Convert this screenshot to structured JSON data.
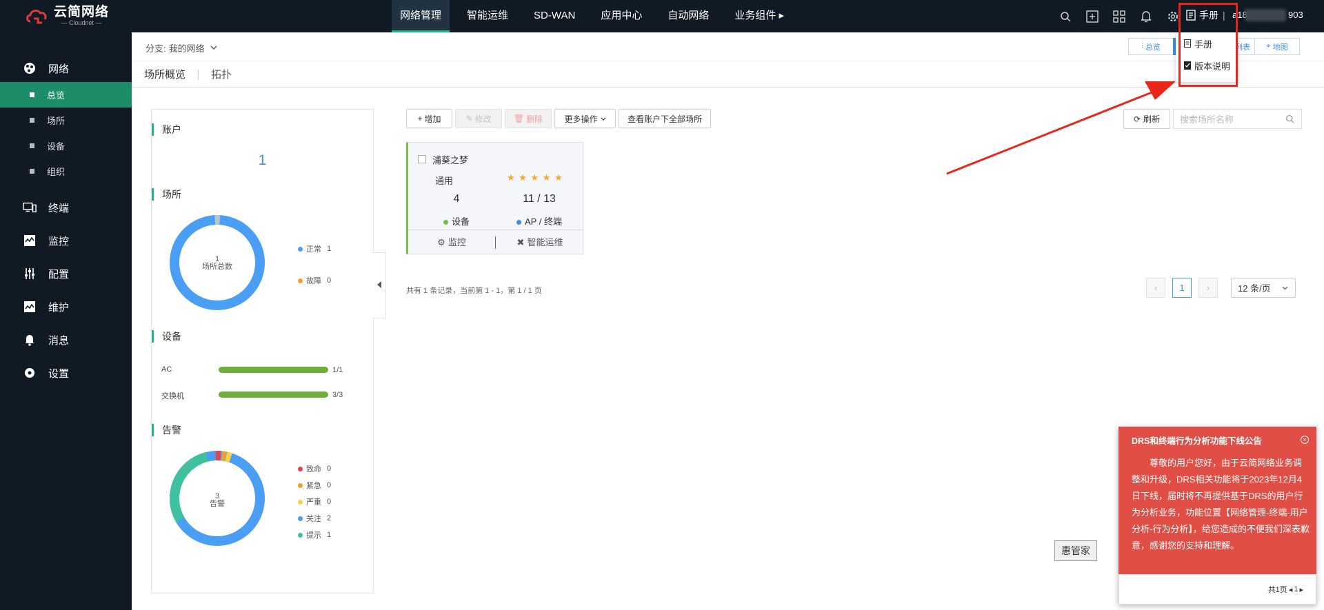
{
  "app": {
    "logo_title": "云简网络",
    "logo_sub": "— Cloudnet —"
  },
  "nav": {
    "items": [
      "网络管理",
      "智能运维",
      "SD-WAN",
      "应用中心",
      "自动网络",
      "业务组件 ▸"
    ]
  },
  "top": {
    "manual_label": "手册",
    "user_prefix": "a18",
    "user_suffix": "903"
  },
  "manual_menu": {
    "items": [
      "手册",
      "版本说明"
    ]
  },
  "sidebar": {
    "groups": [
      {
        "label": "网络",
        "icon": "network-icon"
      },
      {
        "label": "终端",
        "icon": "terminal-icon"
      },
      {
        "label": "监控",
        "icon": "monitor-icon"
      },
      {
        "label": "配置",
        "icon": "config-icon"
      },
      {
        "label": "维护",
        "icon": "maintain-icon"
      },
      {
        "label": "消息",
        "icon": "bell-icon"
      },
      {
        "label": "设置",
        "icon": "gear-icon"
      }
    ],
    "subs": [
      "总览",
      "场所",
      "设备",
      "组织"
    ]
  },
  "branch": {
    "label": "分支:",
    "value": "我的网络"
  },
  "view_buttons": {
    "overview": "总览",
    "list": "列表",
    "map": "地图"
  },
  "tabs": {
    "site_overview": "场所概览",
    "topology": "拓扑"
  },
  "panel": {
    "account": {
      "title": "账户",
      "count": "1"
    },
    "site": {
      "title": "场所",
      "center_num": "1",
      "center_label": "场所总数",
      "legend": [
        {
          "label": "正常",
          "value": "1",
          "color": "#4a9ff5"
        },
        {
          "label": "故障",
          "value": "0",
          "color": "#f0a030"
        }
      ]
    },
    "device": {
      "title": "设备",
      "rows": [
        {
          "label": "AC",
          "value": "1/1",
          "fraction": 1.0
        },
        {
          "label": "交换机",
          "value": "3/3",
          "fraction": 1.0
        }
      ]
    },
    "alarm": {
      "title": "告警",
      "center_num": "3",
      "center_label": "告警",
      "legend": [
        {
          "label": "致命",
          "value": "0",
          "color": "#e0464e"
        },
        {
          "label": "紧急",
          "value": "0",
          "color": "#f0a030"
        },
        {
          "label": "严重",
          "value": "0",
          "color": "#f7d24a"
        },
        {
          "label": "关注",
          "value": "2",
          "color": "#4a9ff5"
        },
        {
          "label": "提示",
          "value": "1",
          "color": "#3fc1a0"
        }
      ]
    }
  },
  "toolbar": {
    "add": "增加",
    "edit": "修改",
    "delete": "删除",
    "more": "更多操作",
    "view_all": "查看账户下全部场所"
  },
  "refresh": "刷新",
  "search": {
    "placeholder": "搜索场所名称"
  },
  "site_card": {
    "name": "浦葵之梦",
    "type": "通用",
    "stars": "★ ★ ★ ★ ★",
    "device_count": "4",
    "ap_count": "11 / 13",
    "device_label": "设备",
    "ap_label": "AP / 终端",
    "monitor": "监控",
    "ops": "智能运维"
  },
  "pager": {
    "info": "共有 1 条记录，当前第 1 - 1，第 1 / 1 页",
    "current": "1",
    "per_page": "12 条/页"
  },
  "hui_button": "惠管家",
  "notice": {
    "title": "DRS和终端行为分析功能下线公告",
    "body": "尊敬的用户您好，由于云简网络业务调整和升级，DRS相关功能将于2023年12月4日下线，届时将不再提供基于DRS的用户行为分析业务，功能位置【网络管理-终端-用户分析-行为分析】，给您造成的不便我们深表歉意，感谢您的支持和理解。",
    "footer": "共1页",
    "page": "1"
  },
  "colors": {
    "accent": "#1bb38a",
    "nav_bg": "#0f1a24",
    "notice_bg": "#e04e45",
    "highlight": "#e8261c"
  }
}
